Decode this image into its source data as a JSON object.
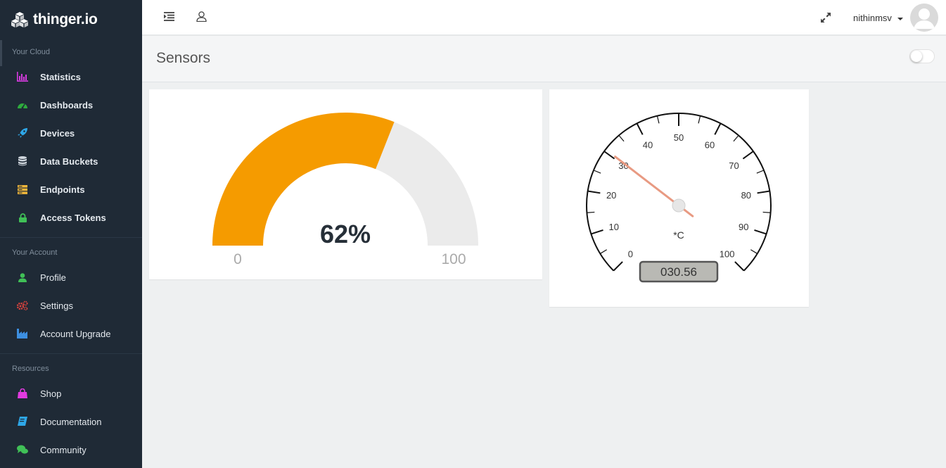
{
  "brand": {
    "name": "thinger.io"
  },
  "sidebar": {
    "sections": [
      {
        "title": "Your Cloud",
        "items": [
          {
            "label": "Statistics",
            "icon": "bar-chart-icon",
            "color": "#d63bdf"
          },
          {
            "label": "Dashboards",
            "icon": "dashboard-icon",
            "color": "#2eaa3e"
          },
          {
            "label": "Devices",
            "icon": "rocket-icon",
            "color": "#2ea7e8"
          },
          {
            "label": "Data Buckets",
            "icon": "database-icon",
            "color": "#cfd6dd"
          },
          {
            "label": "Endpoints",
            "icon": "server-icon",
            "color": "#f0b63a"
          },
          {
            "label": "Access Tokens",
            "icon": "lock-icon",
            "color": "#40c057"
          }
        ]
      },
      {
        "title": "Your Account",
        "items": [
          {
            "label": "Profile",
            "icon": "user-icon",
            "color": "#40c057"
          },
          {
            "label": "Settings",
            "icon": "cogs-icon",
            "color": "#e0443e"
          },
          {
            "label": "Account Upgrade",
            "icon": "industry-icon",
            "color": "#3d8fe0"
          }
        ]
      },
      {
        "title": "Resources",
        "items": [
          {
            "label": "Shop",
            "icon": "shopping-bag-icon",
            "color": "#e23be0"
          },
          {
            "label": "Documentation",
            "icon": "book-icon",
            "color": "#2ea7e8"
          },
          {
            "label": "Community",
            "icon": "comments-icon",
            "color": "#40c057"
          }
        ]
      }
    ]
  },
  "topbar": {
    "menu_icon": "list-indent-icon",
    "profile_icon": "user-outline-icon",
    "fullscreen_icon": "expand-icon",
    "username": "nithinmsv"
  },
  "page": {
    "title": "Sensors",
    "toggle_on": false
  },
  "widgets": {
    "donut": {
      "value_label": "62%",
      "value": 62,
      "min_label": "0",
      "max_label": "100",
      "min": 0,
      "max": 100,
      "fill_color": "#f59b00",
      "track_color": "#ebebeb"
    },
    "meter": {
      "unit": "*C",
      "display": "030.56",
      "value": 30.56,
      "min": 0,
      "max": 100,
      "tick_labels": [
        "0",
        "10",
        "20",
        "30",
        "40",
        "50",
        "60",
        "70",
        "80",
        "90",
        "100"
      ]
    }
  }
}
